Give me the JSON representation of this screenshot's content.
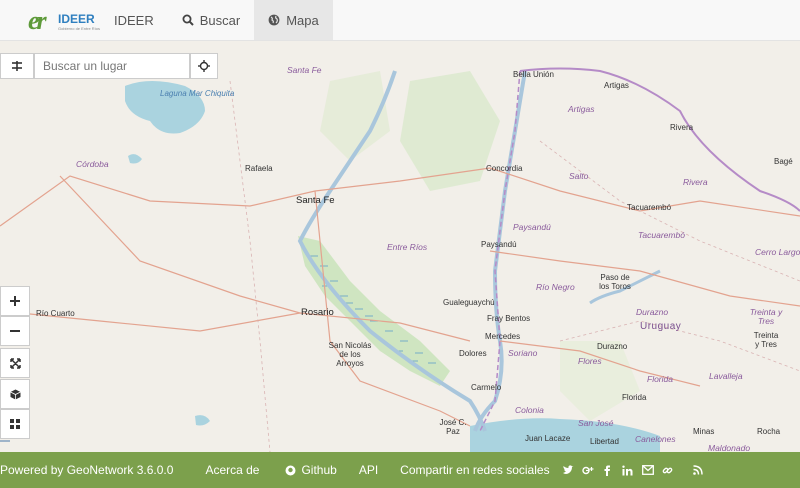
{
  "header": {
    "logo_letters": "er",
    "logo_text": "IDEER",
    "logo_subtitle": "Gobierno de Entre Ríos",
    "nav": [
      {
        "label": "IDEER"
      },
      {
        "label": "Buscar",
        "icon": "search-icon"
      },
      {
        "label": "Mapa",
        "icon": "globe-icon",
        "active": true
      }
    ]
  },
  "map": {
    "search_placeholder": "Buscar un lugar",
    "labels": {
      "santa_fe_region": "Santa Fe",
      "laguna": "Laguna Mar Chiquita",
      "cordoba": "Córdoba",
      "rafaela": "Rafaela",
      "santa_fe_city": "Santa Fe",
      "entre_rios": "Entre Ríos",
      "rio_cuarto": "Río Cuarto",
      "rosario": "Rosario",
      "san_nicolas": "San Nicolás de los Arroyos",
      "bella_union": "Bella Unión",
      "artigas_city": "Artigas",
      "artigas_region": "Artigas",
      "rivera_city": "Rivera",
      "rivera_region": "Rivera",
      "concordia": "Concordia",
      "salto": "Salto",
      "bage": "Bagé",
      "tacuarembo_city": "Tacuarembó",
      "paysandu_region": "Paysandú",
      "tacuarembo_region": "Tacuarembó",
      "paysandu_city": "Paysandú",
      "cerro_largo": "Cerro Largo",
      "paso_toros": "Paso de los Toros",
      "rio_negro": "Río Negro",
      "gualeguaychu": "Gualeguaychú",
      "fray_bentos": "Fray Bentos",
      "durazno_region": "Durazno",
      "uruguay": "Uruguay",
      "treinta_region": "Treinta y Tres",
      "mercedes": "Mercedes",
      "dolores": "Dolores",
      "soriano": "Soriano",
      "durazno_city": "Durazno",
      "treinta_city": "Treinta y Tres",
      "flores": "Flores",
      "carmelo": "Carmelo",
      "florida_region": "Florida",
      "lavalleja": "Lavalleja",
      "colonia": "Colonia",
      "florida_city": "Florida",
      "jose_c_paz": "José C. Paz",
      "san_jose": "San José",
      "minas": "Minas",
      "rocha": "Rocha",
      "juan_lacaze": "Juan Lacaze",
      "libertad": "Libertad",
      "canelones": "Canelones",
      "maldonado": "Maldonado"
    }
  },
  "footer": {
    "powered": "Powered by GeoNetwork 3.6.0.0",
    "about": "Acerca de",
    "github": "Github",
    "api": "API",
    "share": "Compartir en redes sociales"
  },
  "colors": {
    "footer_bg": "#7ca04c",
    "river": "#a9c6dc",
    "border_purple": "#b58bc7",
    "road": "#e3a38f"
  }
}
